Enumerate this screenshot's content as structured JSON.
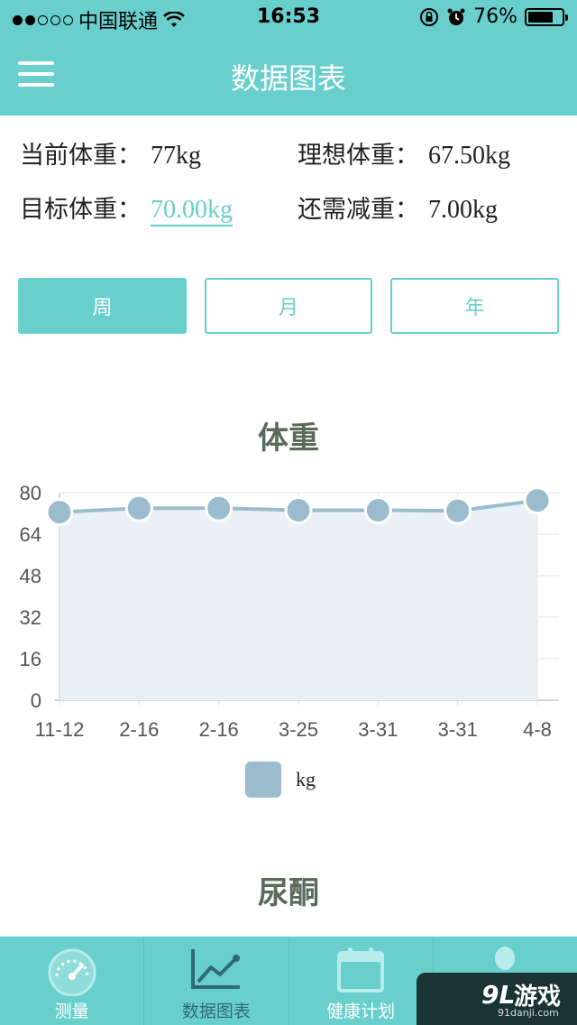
{
  "status_bar": {
    "carrier": "中国联通",
    "time": "16:53",
    "battery": "76%",
    "battery_level": 0.76
  },
  "nav": {
    "title": "数据图表"
  },
  "stats": {
    "current_label": "当前体重：",
    "current_value": "77kg",
    "ideal_label": "理想体重：",
    "ideal_value": "67.50kg",
    "target_label": "目标体重：",
    "target_value": "70.00kg",
    "remaining_label": "还需减重：",
    "remaining_value": "7.00kg"
  },
  "segments": [
    "周",
    "月",
    "年"
  ],
  "weight_chart_title": "体重",
  "ketone_chart_title": "尿酮",
  "chart_data": {
    "type": "line",
    "title": "体重",
    "categories": [
      "11-12",
      "2-16",
      "2-16",
      "3-25",
      "3-31",
      "3-31",
      "4-8"
    ],
    "series": [
      {
        "name": "kg",
        "values": [
          72.5,
          74.0,
          74.0,
          73.2,
          73.2,
          73.0,
          77.0
        ]
      }
    ],
    "yticks": [
      0,
      16,
      32,
      48,
      64,
      80
    ],
    "ylim": [
      0,
      80
    ],
    "grid": true,
    "legend": "bottom-center",
    "colors": {
      "line": "#9bbccd",
      "fill": "#e8f0f5",
      "grid": "#e3e3e3"
    }
  },
  "tabs": [
    {
      "label": "测量",
      "icon": "speedometer-icon"
    },
    {
      "label": "数据图表",
      "icon": "line-chart-icon"
    },
    {
      "label": "健康计划",
      "icon": "calendar-icon"
    },
    {
      "label": "",
      "icon": "profile-icon"
    }
  ],
  "watermark": {
    "brand": "游戏",
    "prefix": "9L",
    "url": "91danji.com"
  },
  "colors": {
    "accent": "#69cfcd",
    "accent_dark": "#2f6b75",
    "title_text": "#5a6b5a"
  }
}
